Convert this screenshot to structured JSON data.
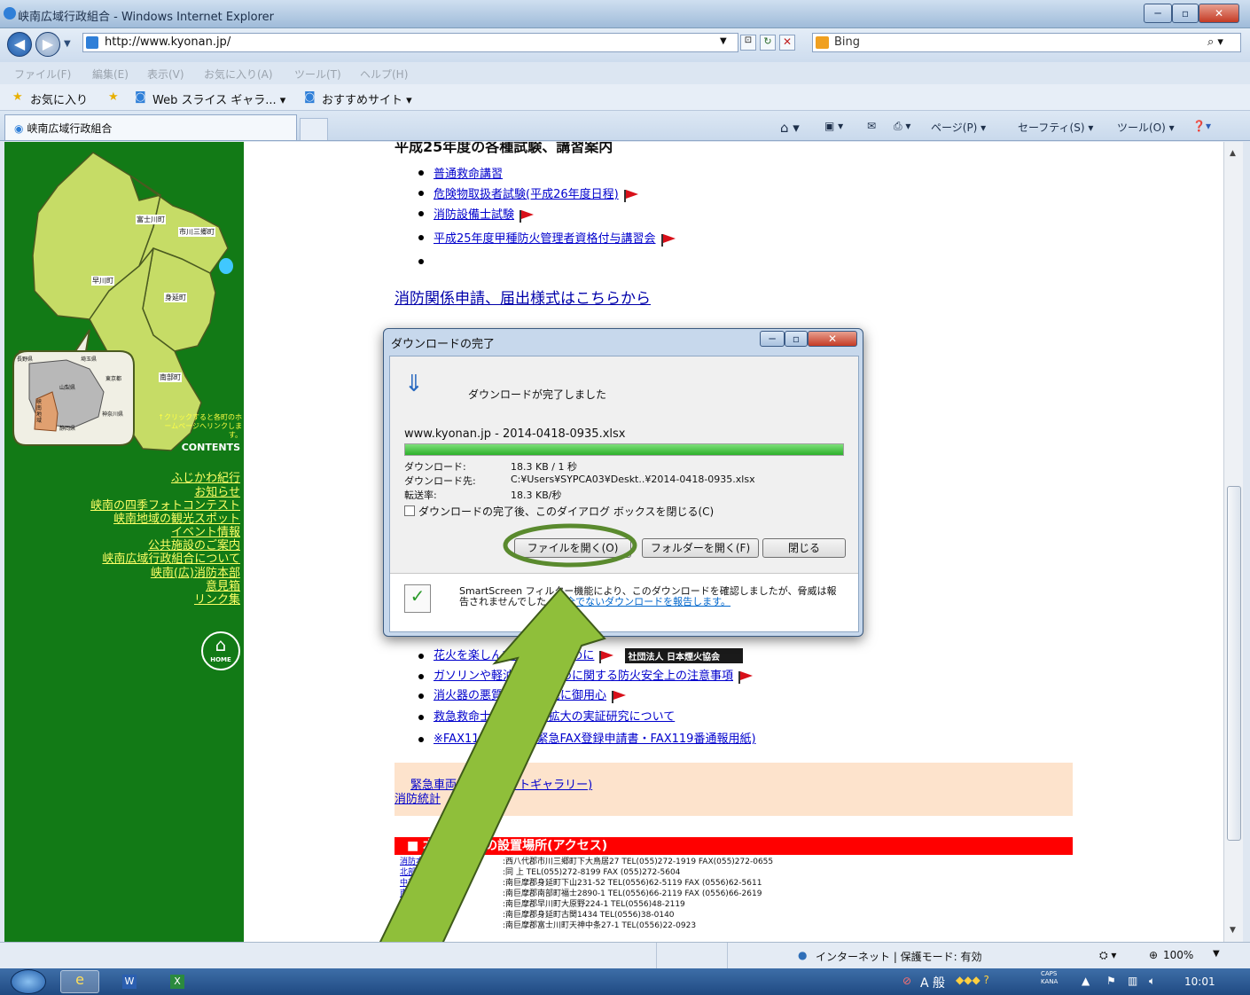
{
  "window": {
    "title": "峡南広域行政組合 - Windows Internet Explorer"
  },
  "address": {
    "url": "http://www.kyonan.jp/",
    "search_engine": "Bing"
  },
  "menu": [
    "ファイル(F)",
    "編集(E)",
    "表示(V)",
    "お気に入り(A)",
    "ツール(T)",
    "ヘルプ(H)"
  ],
  "favorites": {
    "label": "お気に入り",
    "items": [
      "Web スライス ギャラ... ▾",
      "おすすめサイト ▾"
    ]
  },
  "tab": {
    "title": "峡南広域行政組合"
  },
  "commands": [
    "ページ(P) ▾",
    "セーフティ(S) ▾",
    "ツール(O) ▾"
  ],
  "sidebar": {
    "map_towns": [
      "富士川町",
      "市川三郷町",
      "早川町",
      "身延町",
      "南部町"
    ],
    "inset_prefs": [
      "長野県",
      "埼玉県",
      "東京都",
      "山梨県",
      "峡南地域",
      "神奈川県",
      "静岡県"
    ],
    "map_note": "↑クリックすると各町のホームページへリンクします。",
    "contents_label": "CONTENTS",
    "links": [
      "ふじかわ紀行",
      "お知らせ",
      "峡南の四季フォトコンテスト",
      "峡南地域の観光スポット",
      "イベント情報",
      "公共施設のご案内",
      "峡南広域行政組合について",
      "峡南(広)消防本部",
      "意見箱",
      "リンク集"
    ],
    "home_label": "HOME"
  },
  "content": {
    "heading_partial": "平成25年度の各種試験、講習案内",
    "exam_links": [
      "普通救命講習",
      "危険物取扱者試験(平成26年度日程)",
      "消防設備士試験",
      "平成25年度甲種防火管理者資格付与講習会"
    ],
    "forms_link": "消防関係申請、届出様式はこちらから",
    "notice_links": [
      "花火を楽しんでいただくために",
      "ガソリンや軽油の買いだめに関する防火安全上の注意事項",
      "消火器の悪質な訪問販売に御用心",
      "救急救命士による処置拡大の実証研究について",
      "※FAX119について(緊急FAX登録申請書・FAX119番通報用紙)"
    ],
    "hanabi_badge": "社団法人 日本煙火協会",
    "gallery_link": "緊急車両の紹介(フォトギャラリー)",
    "stats_link": "消防統計",
    "access_header": "■ 本部・署等の設置場所(アクセス)",
    "access_rows": [
      {
        "name": "消防本部",
        "detail": ":西八代郡市川三郷町下大鳥居27  TEL(055)272-1919 FAX(055)272-0655"
      },
      {
        "name": "北部消防署",
        "detail": ":同 上   TEL(055)272-8199  FAX (055)272-5604"
      },
      {
        "name": "中部消防署",
        "detail": ":南巨摩郡身延町下山231-52  TEL(0556)62-5119  FAX (0556)62-5611"
      },
      {
        "name": "南部消防署",
        "detail": ":南巨摩郡南部町福士2890-1   TEL(0556)66-2119  FAX (0556)66-2619"
      },
      {
        "name": "早川分駐所",
        "detail": ":南巨摩郡早川町大原野224-1    TEL(0556)48-2119"
      },
      {
        "name": "身延分駐所",
        "detail": ":南巨摩郡身延町古関1434    TEL(0556)38-0140"
      },
      {
        "name": "富士川分駐所",
        "detail": ":南巨摩郡富士川町天神中条27-1     TEL(0556)22-0923"
      }
    ]
  },
  "dialog": {
    "title": "ダウンロードの完了",
    "message": "ダウンロードが完了しました",
    "filename": "www.kyonan.jp - 2014-0418-0935.xlsx",
    "progress": 1.0,
    "label_downloaded": "ダウンロード:",
    "value_downloaded": "18.3 KB / 1 秒",
    "label_dest": "ダウンロード先:",
    "value_dest": "C:¥Users¥SYPCA03¥Deskt..¥2014-0418-0935.xlsx",
    "label_rate": "転送率:",
    "value_rate": "18.3 KB/秒",
    "checkbox_label": "ダウンロードの完了後、このダイアログ ボックスを閉じる(C)",
    "btn_open": "ファイルを開く(O)",
    "btn_folder": "フォルダーを開く(F)",
    "btn_close": "閉じる",
    "smartscreen_text": "SmartScreen フィルター機能により、このダウンロードを確認しましたが、脅威は報告されませんでした。",
    "smartscreen_link": "安全でないダウンロードを報告します。"
  },
  "status": {
    "zone": "インターネット | 保護モード: 有効",
    "zoom": "100%"
  },
  "taskbar": {
    "time": "10:01",
    "ime": "A 般",
    "caps": "CAPS",
    "kana": "KANA"
  },
  "colors": {
    "sidebar_green": "#127a16",
    "highlight_circle": "#5a8a2e",
    "arrow": "#8fbf3a",
    "access_red": "#ff0000",
    "box_peach": "#fde3cc"
  }
}
